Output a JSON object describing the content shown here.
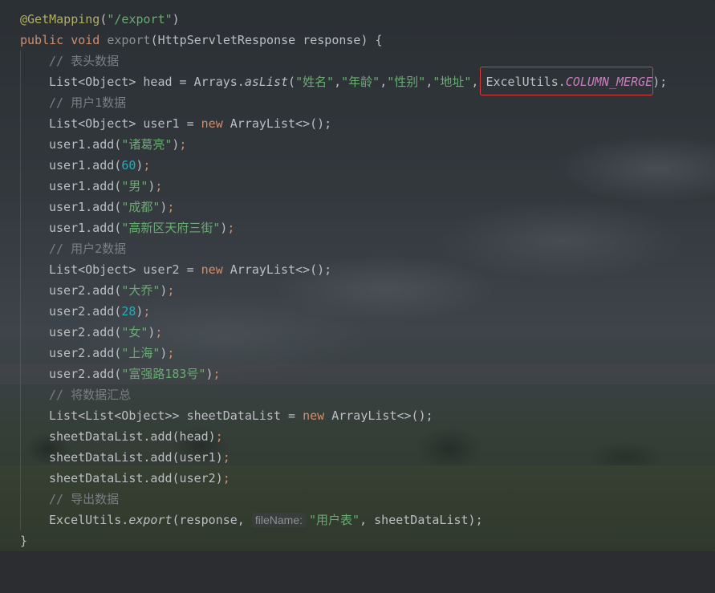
{
  "code": {
    "annotation": "@GetMapping",
    "mapping_path": "\"/export\"",
    "kw_public": "public",
    "kw_void": "void",
    "method_name": "export",
    "params": "(HttpServletResponse response) {",
    "comment_head": "// 表头数据",
    "head_decl_a": "List<Object> head = Arrays.",
    "head_aslist": "asList",
    "head_open": "(",
    "head_col1": "\"姓名\"",
    "head_col2": "\"年龄\"",
    "head_col3": "\"性别\"",
    "head_col4": "\"地址\"",
    "comma": ",",
    "comma_space": ", ",
    "excel_utils": "ExcelUtils.",
    "column_merge": "COLUMN_MERGE",
    "close_semicolon": ");",
    "comment_user1": "// 用户1数据",
    "user1_decl": "List<Object> user1 = ",
    "kw_new": "new",
    "arraylist_new": " ArrayList<>();",
    "user1_add": "user1.add(",
    "user1_name": "\"诸葛亮\"",
    "user1_age": "60",
    "user1_gender": "\"男\"",
    "user1_city": "\"成都\"",
    "user1_addr": "\"高新区天府三街\"",
    "comment_user2": "// 用户2数据",
    "user2_decl": "List<Object> user2 = ",
    "user2_add": "user2.add(",
    "user2_name": "\"大乔\"",
    "user2_age": "28",
    "user2_gender": "\"女\"",
    "user2_city": "\"上海\"",
    "user2_addr": "\"富强路183号\"",
    "comment_sum": "// 将数据汇总",
    "sheet_decl": "List<List<Object>> sheetDataList = ",
    "sheet_add_head": "sheetDataList.add(head)",
    "sheet_add_user1": "sheetDataList.add(user1)",
    "sheet_add_user2": "sheetDataList.add(user2)",
    "semicolon": ";",
    "comment_export": "// 导出数据",
    "export_call_a": "ExcelUtils.",
    "export_fn": "export",
    "export_call_b": "(response, ",
    "param_hint": "fileName:",
    "file_name": "\"用户表\"",
    "export_call_c": ", sheetDataList);",
    "closing_brace": "}"
  },
  "colors": {
    "keyword": "#cf8e6d",
    "string": "#6aab73",
    "number": "#2aacb8",
    "comment": "#7a7e85",
    "annotation": "#b3ae60",
    "constant": "#c77dbb",
    "highlight_box": "#e03a3a"
  }
}
